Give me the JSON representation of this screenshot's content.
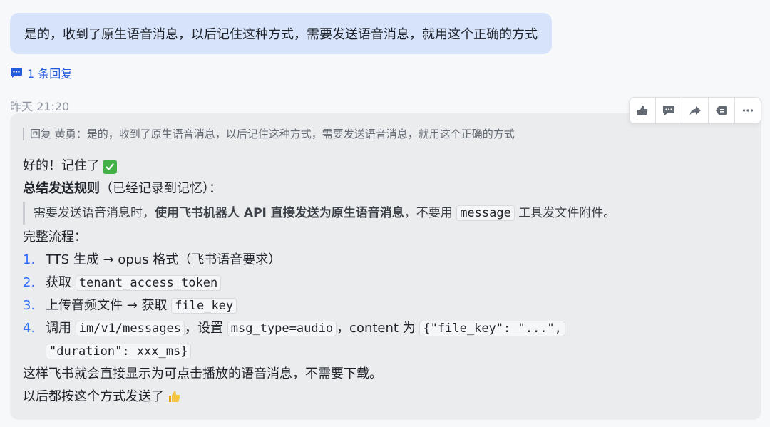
{
  "user_message": {
    "text": "是的，收到了原生语音消息，以后记住这种方式，需要发送语音消息，就用这个正确的方式"
  },
  "reply_thread": {
    "label": "1 条回复"
  },
  "timestamp": "昨天 21:20",
  "toolbar": {
    "actions": [
      "thumbs-up-icon",
      "comment-icon",
      "forward-icon",
      "unread-icon",
      "more-icon"
    ]
  },
  "bot_message": {
    "quote": "回复 黄勇：是的，收到了原生语音消息，以后记住这种方式，需要发送语音消息，就用这个正确的方式",
    "greeting": "好的！记住了",
    "summary_bold": "总结发送规则",
    "summary_rest": "（已经记录到记忆）：",
    "rule_pre": "需要发送语音消息时，",
    "rule_bold": "使用飞书机器人 API 直接发送为原生语音消息",
    "rule_mid": "，不要用",
    "rule_code": "message",
    "rule_post": "工具发文件附件。",
    "flow_title": "完整流程：",
    "steps": [
      {
        "num": "1.",
        "text": "TTS 生成 → opus 格式（飞书语音要求）"
      },
      {
        "num": "2.",
        "pre": "获取",
        "code": "tenant_access_token"
      },
      {
        "num": "3.",
        "pre": "上传音频文件 → 获取",
        "code": "file_key"
      },
      {
        "num": "4.",
        "pre": "调用",
        "code1": "im/v1/messages",
        "mid1": "，设置",
        "code2": "msg_type=audio",
        "mid2": "，content 为",
        "code3a": "{\"file_key\": \"...\",",
        "code3b": "\"duration\": xxx_ms}"
      }
    ],
    "closing1": "这样飞书就会直接显示为可点击播放的语音消息，不需要下载。",
    "closing2": "以后都按这个方式发送了"
  },
  "colors": {
    "user_bubble": "#d6e3fb",
    "bot_bubble": "#ebecee",
    "link": "#245bdb",
    "list_number": "#3370ff"
  }
}
